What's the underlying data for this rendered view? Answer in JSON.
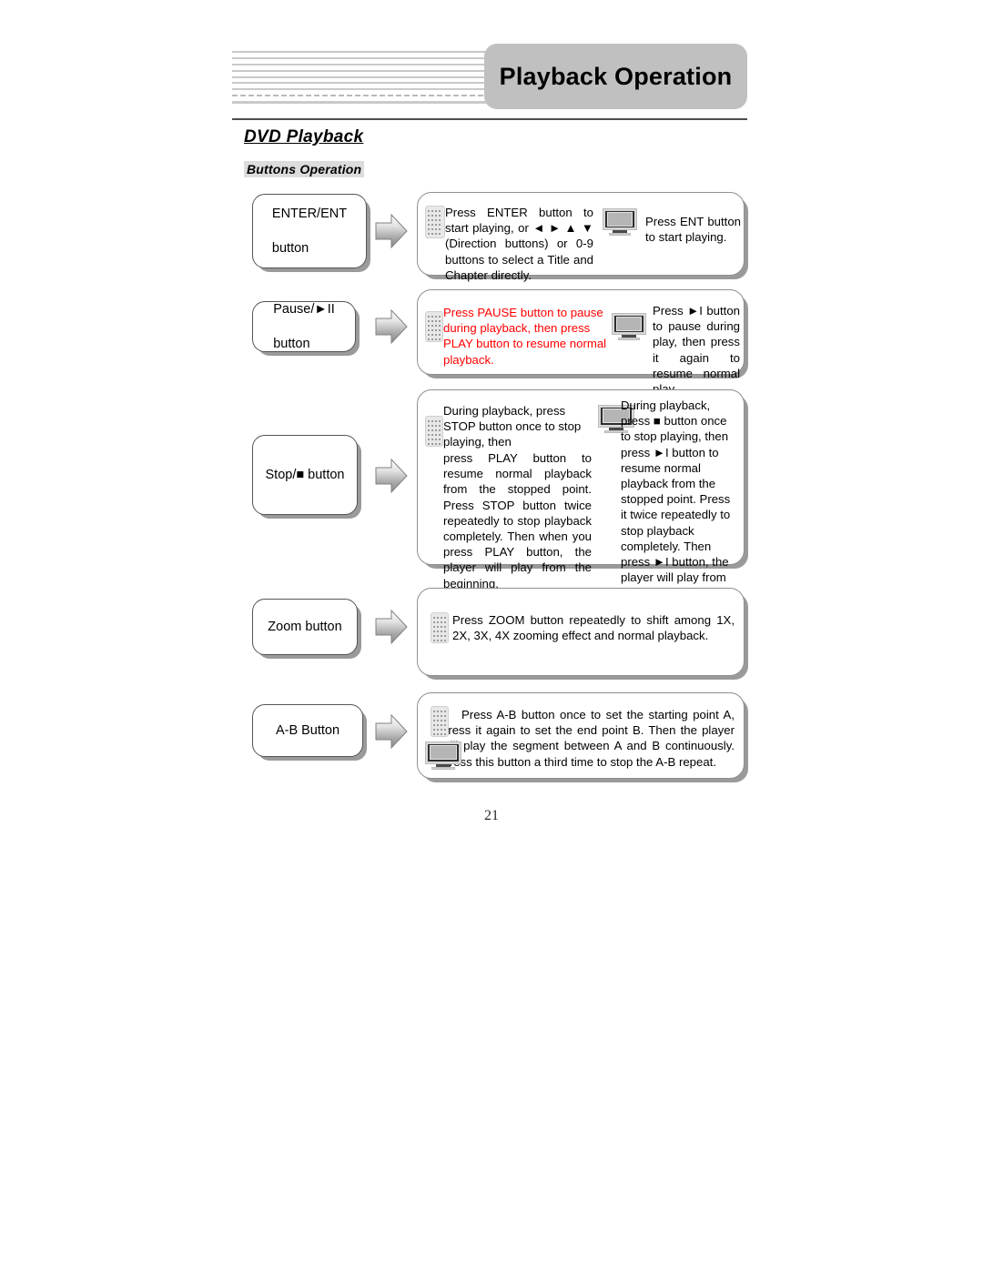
{
  "header": {
    "title": "Playback Operation",
    "decoration_lines": 9
  },
  "section": {
    "title": "DVD Playback",
    "subtitle": "Buttons Operation"
  },
  "colors": {
    "header_band": "#c0c0c0",
    "highlight_text": "#ff0000",
    "subtitle_background": "#dcdcdc",
    "shadow": "#9a9a9a"
  },
  "rows": [
    {
      "id": "enter-ent",
      "label": "ENTER/ENT\nbutton",
      "label_lines": [
        "ENTER/ENT",
        "button"
      ],
      "remote_text": "Press ENTER button to start playing, or ◄ ► ▲ ▼ (Direction buttons) or 0-9 buttons to select a Title and Chapter directly.",
      "remote_text_parts": {
        "before": "Press ENTER button to start playing, or ",
        "arrows": "◄  ►  ▲",
        "after": "▼ (Direction buttons) or 0-9 buttons to select a Title and Chapter directly."
      },
      "tv_text": "Press ENT button to start playing.",
      "remote_icon": "remote-control-icon",
      "tv_icon": "television-icon",
      "arrow_icon": "right-arrow-icon",
      "highlighted": false
    },
    {
      "id": "pause",
      "label": "Pause/►II\nbutton",
      "label_lines": [
        "Pause/►II",
        "button"
      ],
      "remote_text": "Press PAUSE button to pause during playback, then press PLAY button to resume normal playback.",
      "tv_text": "Press ►I button to pause during play, then press it again to resume normal play.",
      "remote_icon": "remote-control-icon",
      "tv_icon": "television-icon",
      "arrow_icon": "right-arrow-icon",
      "highlighted": true
    },
    {
      "id": "stop",
      "label": "Stop/■ button",
      "label_lines": [
        "Stop/■ button"
      ],
      "remote_text": "During playback, press STOP button once to stop playing, then press PLAY button to resume normal playback from the stopped point. Press STOP button twice repeatedly to stop playback completely. Then when you press PLAY button, the player will play from the beginning.",
      "remote_text_head": "During playback, press STOP button once to stop playing, then",
      "remote_text_body": "press PLAY button to resume normal playback from the stopped point. Press STOP button twice repeatedly to stop playback completely. Then when you press PLAY button, the player will play from the beginning.",
      "tv_text": "During playback, press ■ button once to stop playing, then press ►I button to resume normal playback from the stopped point. Press it twice repeatedly to stop playback completely. Then press ►I button, the player will play from the beginning.",
      "remote_icon": "remote-control-icon",
      "tv_icon": "television-icon",
      "arrow_icon": "right-arrow-icon",
      "highlighted": false
    },
    {
      "id": "zoom",
      "label": "Zoom button",
      "label_lines": [
        "Zoom button"
      ],
      "remote_text": "Press ZOOM button repeatedly to shift among 1X, 2X, 3X, 4X zooming effect and normal playback.",
      "tv_text": "",
      "remote_icon": "remote-control-icon",
      "arrow_icon": "right-arrow-icon",
      "highlighted": false
    },
    {
      "id": "a-b",
      "label": "A-B Button",
      "label_lines": [
        "A-B Button"
      ],
      "remote_text": "Press A-B button once to set the starting point A, press it again to set the end point B. Then the player will play the segment between A and B continuously. Press this button a third time to stop the A-B repeat.",
      "tv_text": "",
      "remote_icon": "remote-control-icon",
      "tv_icon": "television-icon",
      "arrow_icon": "right-arrow-icon",
      "highlighted": false
    }
  ],
  "footer": {
    "page_number": "21"
  }
}
